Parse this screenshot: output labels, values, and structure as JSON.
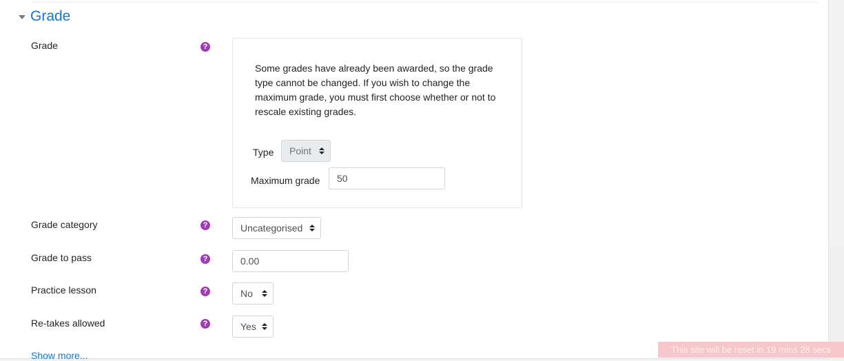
{
  "section": {
    "title": "Grade"
  },
  "grade": {
    "label": "Grade",
    "notice": "Some grades have already been awarded, so the grade type cannot be changed. If you wish to change the maximum grade, you must first choose whether or not to rescale existing grades.",
    "type_label": "Type",
    "type_value": "Point",
    "max_label": "Maximum grade",
    "max_value": "50"
  },
  "grade_category": {
    "label": "Grade category",
    "value": "Uncategorised"
  },
  "grade_to_pass": {
    "label": "Grade to pass",
    "value": "0.00"
  },
  "practice_lesson": {
    "label": "Practice lesson",
    "value": "No"
  },
  "retakes_allowed": {
    "label": "Re-takes allowed",
    "value": "Yes"
  },
  "help_glyph": "?",
  "show_more": "Show more...",
  "reset_banner": "This site will be reset in 19 mins 28 secs",
  "colors": {
    "accent": "#1177d1",
    "help": "#a13bb5",
    "banner": "#f7c6ca"
  }
}
